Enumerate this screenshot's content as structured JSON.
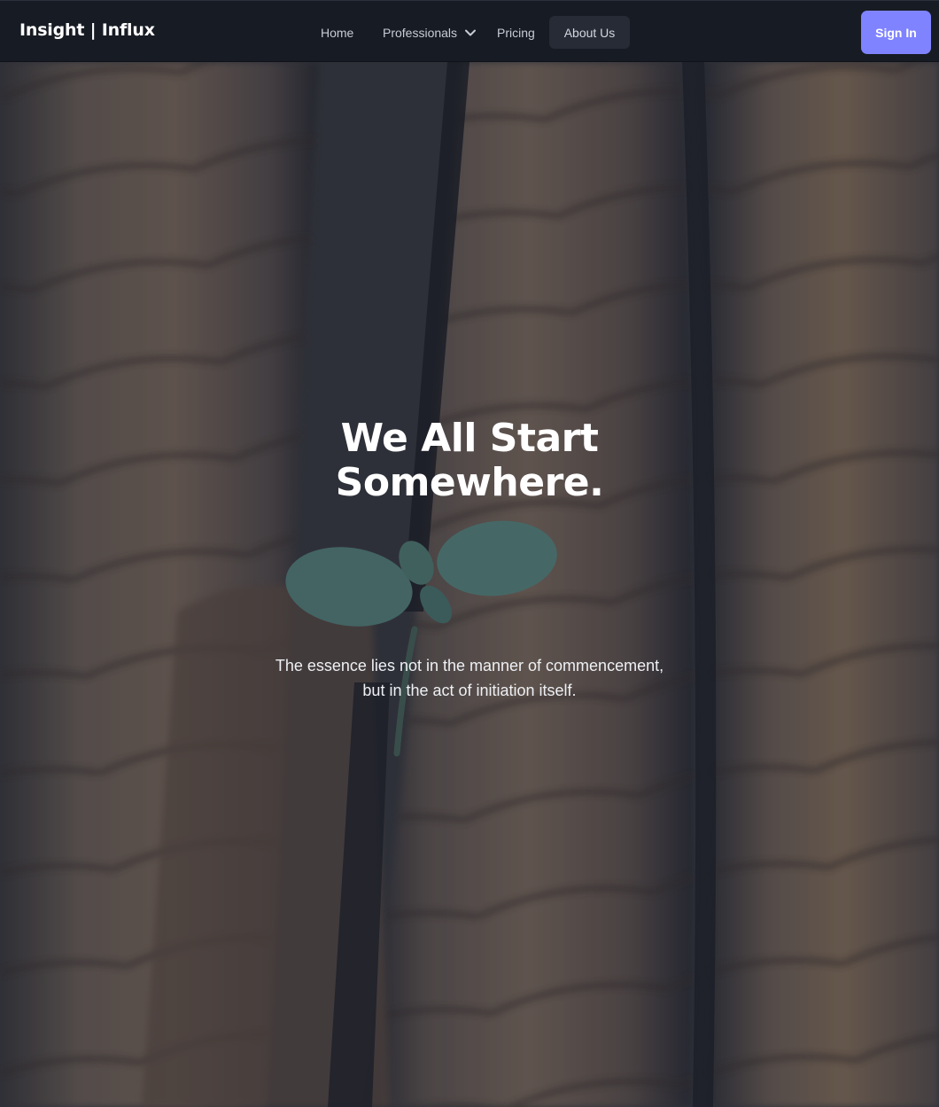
{
  "brand": {
    "name": "Insight | Influx"
  },
  "nav": {
    "items": [
      {
        "label": "Home"
      },
      {
        "label": "Professionals",
        "icon": "chevron-down-icon"
      },
      {
        "label": "Pricing"
      },
      {
        "label": "About Us",
        "active": true
      }
    ],
    "signin_label": "Sign In"
  },
  "hero": {
    "headline_line1": "We All Start",
    "headline_line2": "Somewhere.",
    "subtext_line1": "The essence lies not in the manner of commencement,",
    "subtext_line2": "but in the act of initiation itself.",
    "background_image": "rusty-rebar-seedling-photo"
  },
  "colors": {
    "navbar_bg": "#171b23",
    "accent": "#7f83ff",
    "active_tab_bg": "#262b35",
    "text_primary": "#ffffff"
  }
}
